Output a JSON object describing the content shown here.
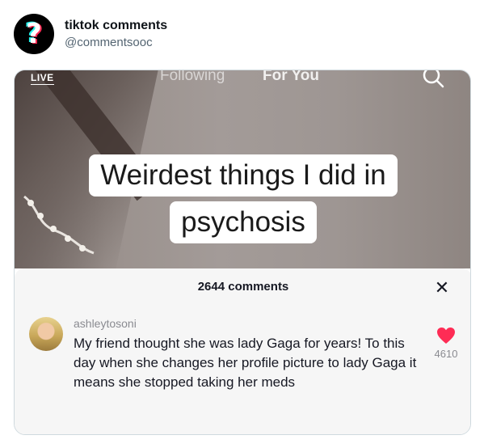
{
  "tweet": {
    "display_name": "tiktok comments",
    "handle": "@commentsooc",
    "avatar_icon": "question-mark-icon"
  },
  "video": {
    "live_label": "LIVE",
    "tabs": [
      {
        "label": "Following"
      },
      {
        "label": "For You"
      }
    ],
    "search_icon": "search-icon",
    "caption_line1": "Weirdest things I did in",
    "caption_line2": "psychosis"
  },
  "comments_panel": {
    "count_label": "2644 comments",
    "close_icon": "close-icon",
    "comment": {
      "username": "ashleytosoni",
      "text": "My friend thought she was lady Gaga for years! To this day when she changes her profile picture to lady Gaga it means she stopped taking her meds",
      "likes": "4610",
      "like_icon": "heart-icon",
      "like_color": "#fe2c55"
    }
  }
}
